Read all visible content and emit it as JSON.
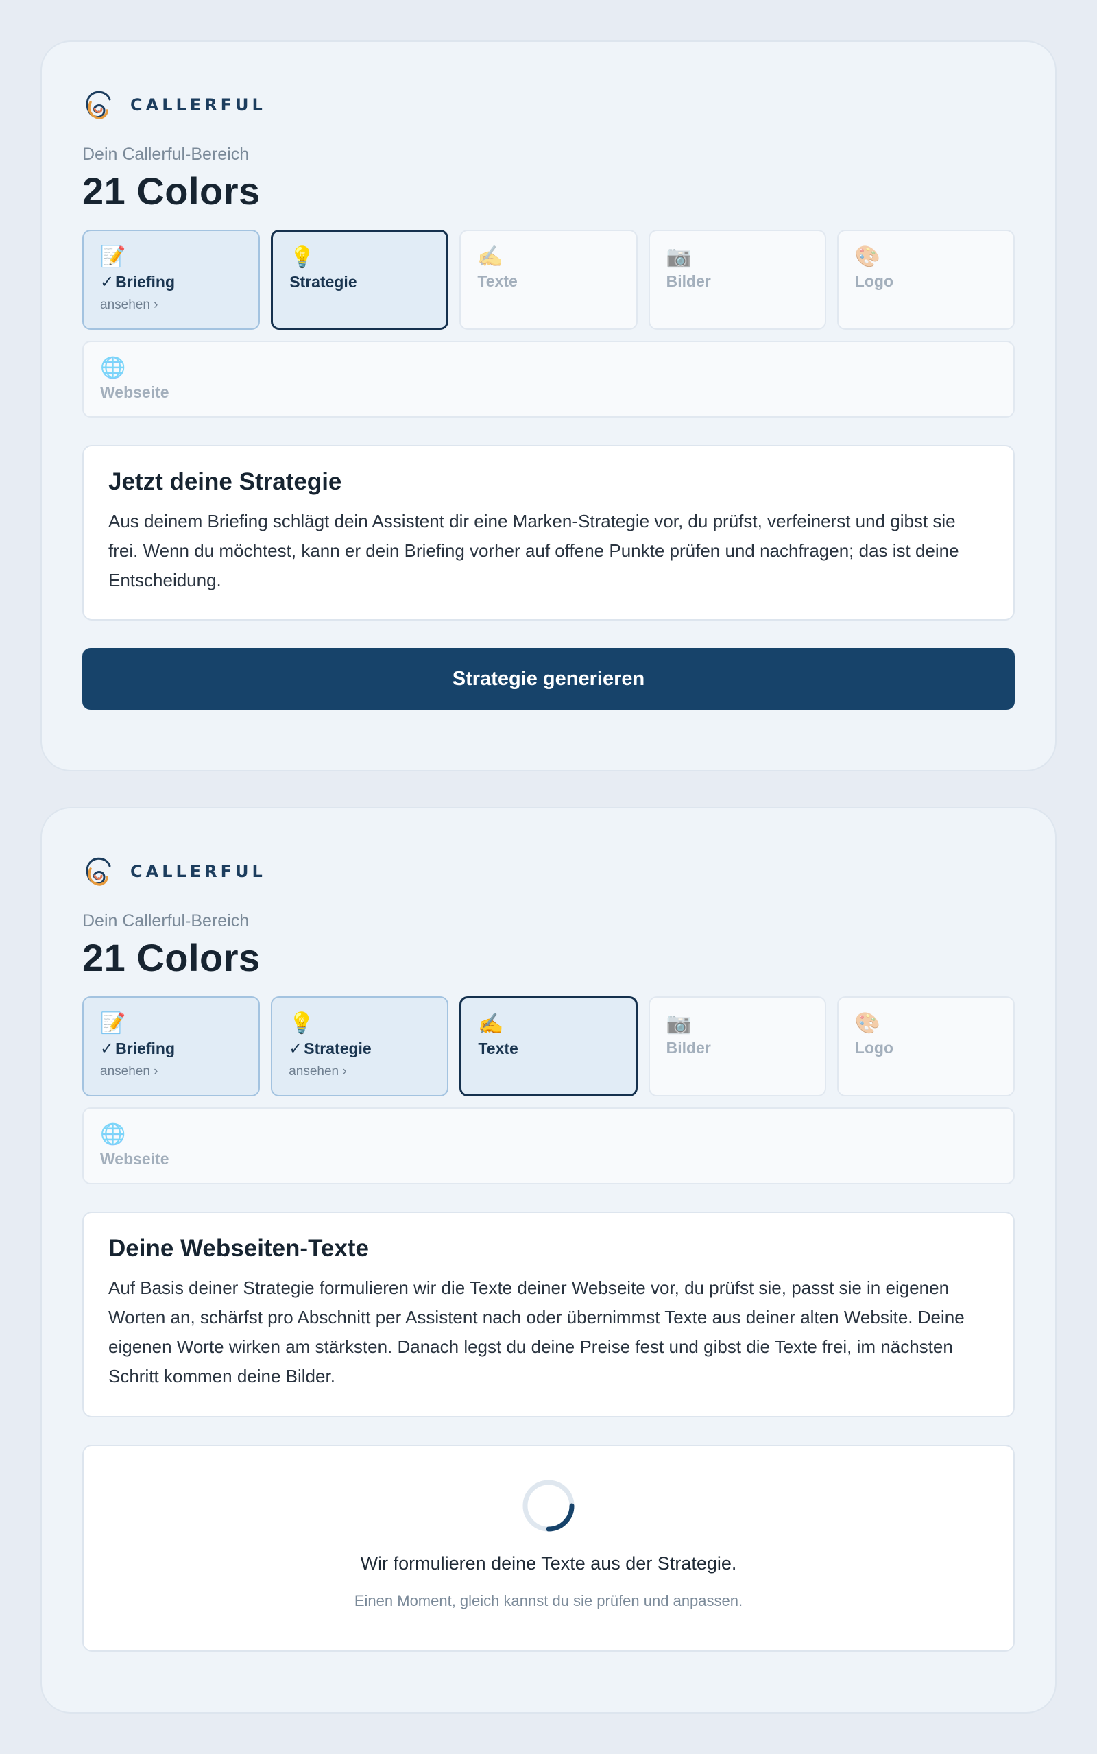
{
  "panels": [
    {
      "brand": "CALLERFUL",
      "area_label": "Dein Callerful-Bereich",
      "company": "21 Colors",
      "steps": [
        {
          "icon": "📝",
          "label": "Briefing",
          "sub": "ansehen ›",
          "state": "done"
        },
        {
          "icon": "💡",
          "label": "Strategie",
          "state": "active"
        },
        {
          "icon": "✍️",
          "label": "Texte",
          "state": "todo"
        },
        {
          "icon": "📷",
          "label": "Bilder",
          "state": "todo"
        },
        {
          "icon": "🎨",
          "label": "Logo",
          "state": "todo"
        },
        {
          "icon": "🌐",
          "label": "Webseite",
          "state": "todo"
        }
      ],
      "card": {
        "title": "Jetzt deine Strategie",
        "text": "Aus deinem Briefing schlägt dein Assistent dir eine Marken-Strategie vor, du prüfst, verfeinerst und gibst sie frei. Wenn du möchtest, kann er dein Briefing vorher auf offene Punkte prüfen und nachfragen; das ist deine Entscheidung."
      },
      "button": "Strategie generieren"
    },
    {
      "brand": "CALLERFUL",
      "area_label": "Dein Callerful-Bereich",
      "company": "21 Colors",
      "steps": [
        {
          "icon": "📝",
          "label": "Briefing",
          "sub": "ansehen ›",
          "state": "done"
        },
        {
          "icon": "💡",
          "label": "Strategie",
          "sub": "ansehen ›",
          "state": "done"
        },
        {
          "icon": "✍️",
          "label": "Texte",
          "state": "active"
        },
        {
          "icon": "📷",
          "label": "Bilder",
          "state": "todo"
        },
        {
          "icon": "🎨",
          "label": "Logo",
          "state": "todo"
        },
        {
          "icon": "🌐",
          "label": "Webseite",
          "state": "todo"
        }
      ],
      "card": {
        "title": "Deine Webseiten-Texte",
        "text": "Auf Basis deiner Strategie formulieren wir die Texte deiner Webseite vor, du prüfst sie, passt sie in eigenen Worten an, schärfst pro Abschnitt per Assistent nach oder übernimmst Texte aus deiner alten Website. Deine eigenen Worte wirken am stärksten. Danach legst du deine Preise fest und gibst die Texte frei, im nächsten Schritt kommen deine Bilder."
      },
      "loading": {
        "main": "Wir formulieren deine Texte aus der Strategie.",
        "sub": "Einen Moment, gleich kannst du sie prüfen und anpassen."
      }
    }
  ],
  "colors": {
    "accent": "#17436a",
    "step_done_bg": "#e1ecf6",
    "step_active_border": "#15314e"
  }
}
